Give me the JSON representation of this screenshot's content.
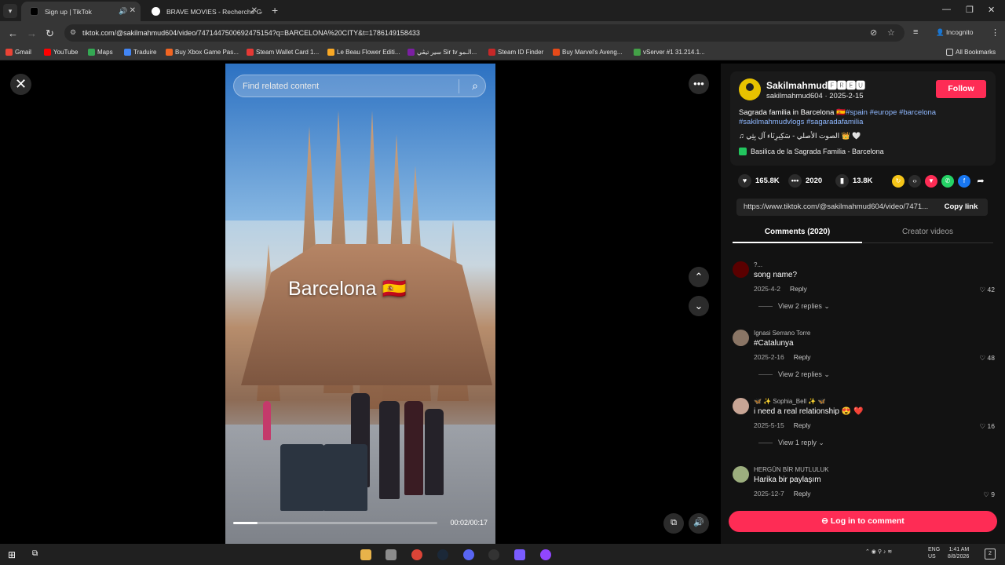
{
  "browser": {
    "tabs": [
      {
        "title": "Sign up | TikTok",
        "active": true
      },
      {
        "title": "BRAVE MOVIES - Recherche Go",
        "active": false
      }
    ],
    "new_tab_label": "+",
    "url": "tiktok.com/@sakilmahmud604/video/7471447500692475154?q=BARCELONA%20CITY&t=1786149158433",
    "incognito_label": "Incognito",
    "bookmarks": [
      {
        "label": "Gmail",
        "color": "#ea4335"
      },
      {
        "label": "YouTube",
        "color": "#ff0000"
      },
      {
        "label": "Maps",
        "color": "#34a853"
      },
      {
        "label": "Traduire",
        "color": "#4285f4"
      },
      {
        "label": "Buy Xbox Game Pas...",
        "color": "#f26522"
      },
      {
        "label": "Steam Wallet Card 1...",
        "color": "#e53935"
      },
      {
        "label": "Le Beau Flower Editi...",
        "color": "#f9a825"
      },
      {
        "label": "سير تيڤي Sir tv الـمو...",
        "color": "#7b1fa2"
      },
      {
        "label": "Steam ID Finder",
        "color": "#c62828"
      },
      {
        "label": "Buy Marvel's Aveng...",
        "color": "#e64a19"
      },
      {
        "label": "vServer #1 31.214.1...",
        "color": "#43a047"
      }
    ],
    "all_bookmarks_label": "All Bookmarks"
  },
  "video": {
    "search_placeholder": "Find related content",
    "overlay_title": "Barcelona 🇪🇸",
    "time": "00:02/00:17",
    "progress": 0.12
  },
  "post": {
    "username": "Sakilmahmud🅵🆁🅴🆄",
    "handle": "sakilmahmud604 · 2025-2-15",
    "follow_label": "Follow",
    "desc_plain": "Sagrada familia in Barcelona 🇪🇸",
    "desc_tags_1": "#spain #europe #barcelona",
    "desc_tags_2": "#sakilmahmudvlogs #sagaradafamilia",
    "music": "♫ الصوت الأصلي - سَكِيرِنَاء آل بِثِي 👑 🤍",
    "location": "Basilica de la Sagrada Familia - Barcelona",
    "likes": "165.8K",
    "comments_count": "2020",
    "saves": "13.8K",
    "link": "https://www.tiktok.com/@sakilmahmud604/video/7471...",
    "copy_label": "Copy link"
  },
  "tabs": {
    "comments": "Comments (2020)",
    "creator": "Creator videos"
  },
  "comments": [
    {
      "user": "?...",
      "text": "song name?",
      "date": "2025-4-2",
      "likes": "42",
      "replies": "View 2 replies",
      "avatar_color": "#5a0000"
    },
    {
      "user": "Ignasi Serrano Torre",
      "text": "#Catalunya",
      "date": "2025-2-16",
      "likes": "48",
      "replies": "View 2 replies",
      "avatar_color": "#8a7565"
    },
    {
      "user": "🦋 ✨ Sophia_Bell ✨ 🦋",
      "text": "i need a real relationship 😍 ❤️",
      "date": "2025-5-15",
      "likes": "16",
      "replies": "View 1 reply",
      "avatar_color": "#c8a595"
    },
    {
      "user": "HERGÜN BİR MUTLULUK",
      "text": "Harika bir paylaşım",
      "date": "2025-12-7",
      "likes": "9",
      "replies": "",
      "avatar_color": "#9cae7e"
    }
  ],
  "reply_label": "Reply",
  "login_label": "Log in to comment",
  "taskbar": {
    "lang": "ENG",
    "region": "US",
    "time": "1:41 AM",
    "date": "8/8/2026",
    "notifications": "2"
  },
  "colors": {
    "accent": "#fe2c55",
    "tag": "#8fb8ff"
  }
}
